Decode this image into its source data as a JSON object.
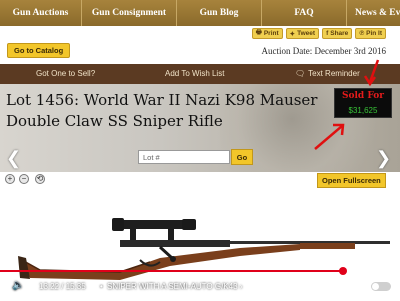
{
  "nav": {
    "items": [
      "Gun Auctions",
      "Gun Consignment",
      "Gun Blog",
      "FAQ",
      "News & Ev"
    ]
  },
  "social": {
    "print": "Print",
    "tweet": "Tweet",
    "share": "Share",
    "pin": "Pin It"
  },
  "catalog": {
    "go_label": "Go to Catalog"
  },
  "auction": {
    "date": "Auction Date: December 3rd 2016"
  },
  "actions": {
    "sell": "Got One to Sell?",
    "wishlist": "Add To Wish List",
    "reminder": "Text Reminder"
  },
  "lot": {
    "title": "Lot 1456: World War II Nazi K98 Mauser Double Claw SS Sniper Rifle",
    "sold_label": "Sold For",
    "sold_amount": "$31,625",
    "search_placeholder": "Lot #",
    "go_label": "Go"
  },
  "viewer": {
    "zoom_in": "+",
    "zoom_out": "−",
    "reset": "⟲",
    "fullscreen_label": "Open Fullscreen"
  },
  "video": {
    "timecode": "13:22 / 15:35",
    "separator": "•",
    "chapter": "SNIPER WITH A SEMI-AUTO G/K43 ›",
    "progress": 0.858
  },
  "colors": {
    "nav_bg": "#98763a",
    "action_bar": "#5b3a22",
    "button_yellow": "#f2c62a",
    "sold_red": "#e31b1b",
    "sold_green": "#37c237",
    "progress_red": "#e0001a"
  }
}
